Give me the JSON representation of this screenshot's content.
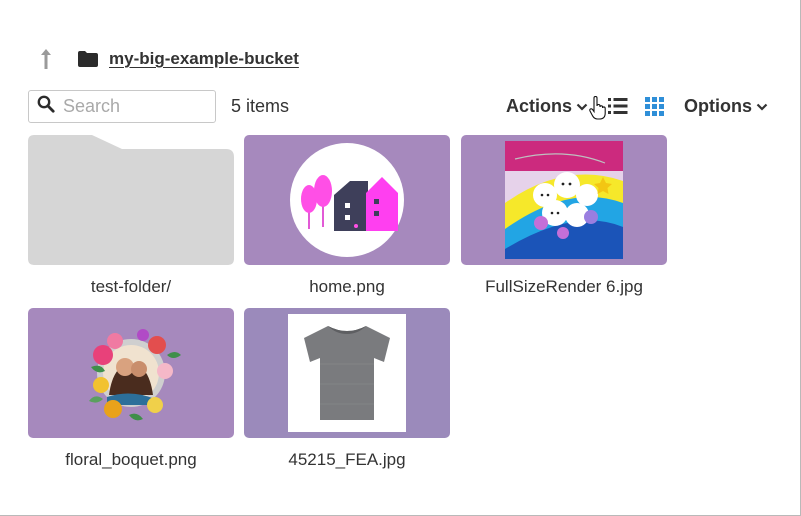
{
  "breadcrumb": {
    "up_icon": "up-arrow-icon",
    "folder_icon": "folder-icon",
    "bucket_name": "my-big-example-bucket"
  },
  "toolbar": {
    "search": {
      "placeholder": "Search",
      "value": "",
      "icon": "search-icon"
    },
    "item_count": "5 items",
    "actions_label": "Actions",
    "list_view_icon": "list-view-icon",
    "grid_view_icon": "grid-view-icon",
    "options_label": "Options"
  },
  "colors": {
    "tile_background": "#a689bd",
    "folder_gray": "#d6d6d6",
    "grid_icon_active": "#2f8fd8"
  },
  "items": [
    {
      "name": "test-folder/",
      "type": "folder"
    },
    {
      "name": "home.png",
      "type": "image"
    },
    {
      "name": "FullSizeRender 6.jpg",
      "type": "image"
    },
    {
      "name": "floral_boquet.png",
      "type": "image"
    },
    {
      "name": "45215_FEA.jpg",
      "type": "image"
    }
  ]
}
